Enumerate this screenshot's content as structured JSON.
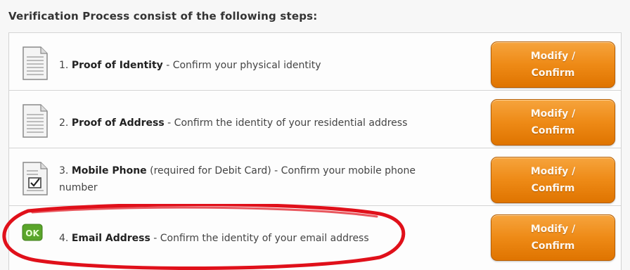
{
  "heading": "Verification Process consist of the following steps:",
  "steps": [
    {
      "number": "1.",
      "label": "Proof of Identity",
      "separator": " - ",
      "description": "Confirm your physical identity",
      "icon": "document-icon",
      "button_line1": "Modify /",
      "button_line2": "Confirm"
    },
    {
      "number": "2.",
      "label": "Proof of Address",
      "separator": " - ",
      "description": "Confirm the identity of your residential address",
      "icon": "document-icon",
      "button_line1": "Modify /",
      "button_line2": "Confirm"
    },
    {
      "number": "3.",
      "label": "Mobile Phone",
      "separator": " (required for Debit Card) - ",
      "description": "Confirm your mobile phone number",
      "icon": "document-checkbox-icon",
      "button_line1": "Modify /",
      "button_line2": "Confirm"
    },
    {
      "number": "4.",
      "label": "Email Address",
      "separator": " - ",
      "description": "Confirm the identity of your email address",
      "icon": "ok-icon",
      "icon_text": "OK",
      "button_line1": "Modify /",
      "button_line2": "Confirm"
    }
  ],
  "colors": {
    "button": "#ee8a16",
    "highlight_ring": "#e0101a",
    "ok_badge": "#5aa52a"
  }
}
